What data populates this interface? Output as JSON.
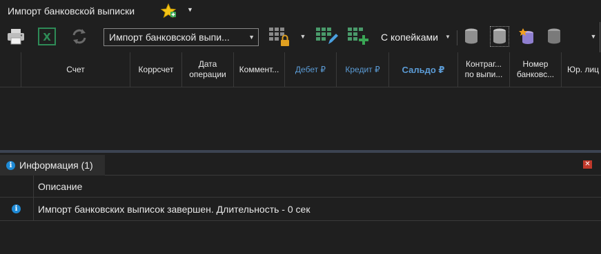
{
  "window": {
    "title": "Импорт банковской выписки"
  },
  "toolbar": {
    "bank_statement_combo": "Импорт банковской выпи...",
    "kopecks_label": "С копейками"
  },
  "grid": {
    "columns": [
      {
        "line1": "Счет",
        "line2": ""
      },
      {
        "line1": "Коррсчет",
        "line2": ""
      },
      {
        "line1": "Дата",
        "line2": "операции"
      },
      {
        "line1": "Коммент...",
        "line2": ""
      },
      {
        "line1": "Дебет ₽",
        "line2": ""
      },
      {
        "line1": "Кредит ₽",
        "line2": ""
      },
      {
        "line1": "Сальдо ₽",
        "line2": ""
      },
      {
        "line1": "Контраг...",
        "line2": "по выпи..."
      },
      {
        "line1": "Номер",
        "line2": "банковс..."
      },
      {
        "line1": "Юр. лиц",
        "line2": ""
      }
    ]
  },
  "info_panel": {
    "tab_label": "Информация (1)",
    "column_header": "Описание",
    "messages": [
      {
        "text": "Импорт банковских выписок завершен. Длительность - 0 сек"
      }
    ]
  },
  "colors": {
    "background": "#1f1f1f",
    "accent_blue": "#5b9bd5",
    "info_icon": "#1e8ad6",
    "close_red": "#c0392b",
    "excel_green": "#2e8b57"
  }
}
